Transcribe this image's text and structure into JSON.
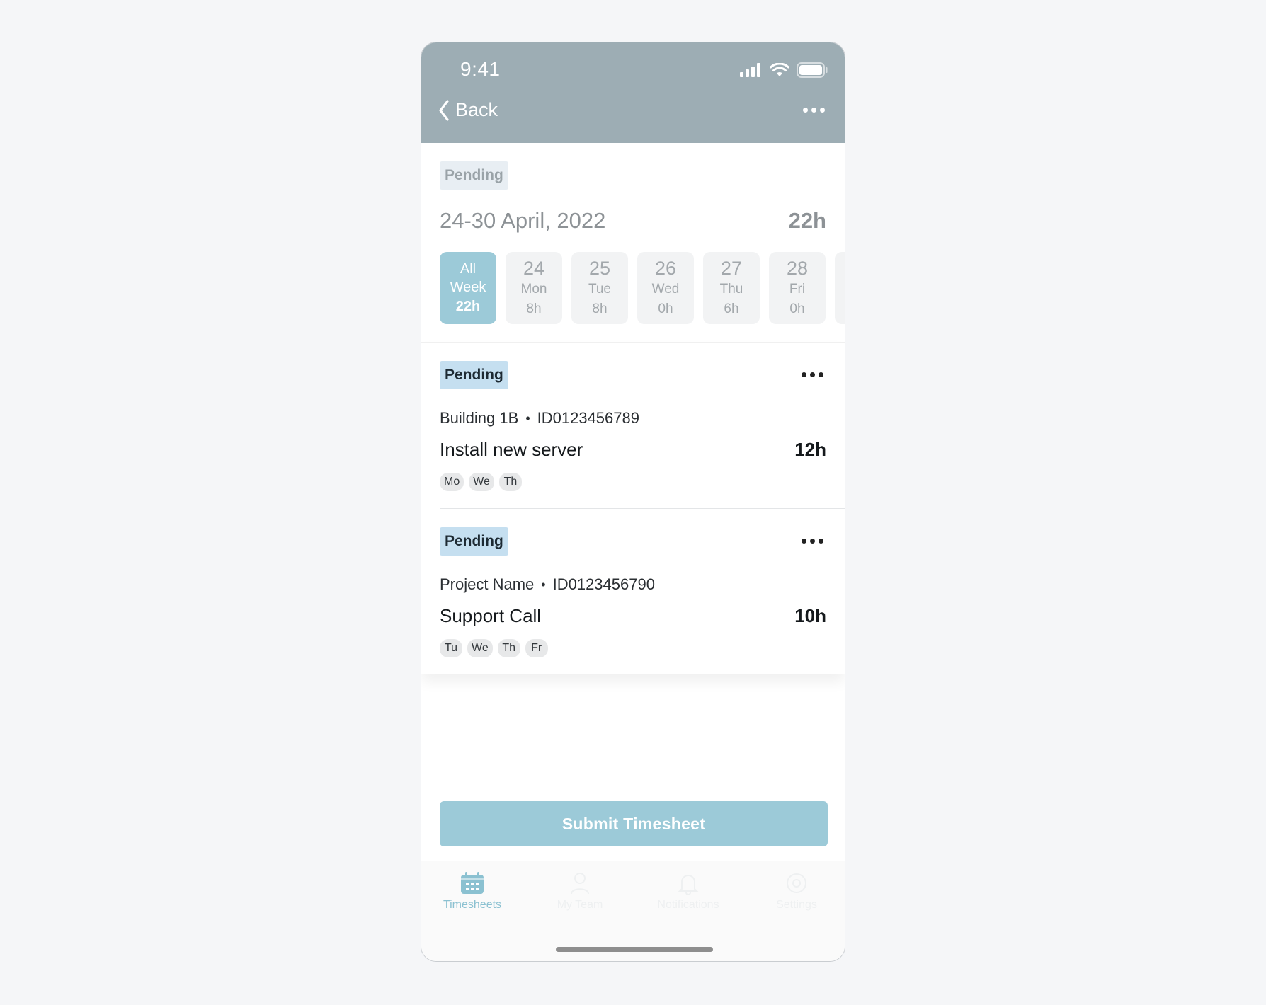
{
  "status_bar": {
    "time": "9:41"
  },
  "nav": {
    "back_label": "Back"
  },
  "summary": {
    "status": "Pending",
    "date_range": "24-30 April, 2022",
    "total_hours": "22h",
    "days": [
      {
        "line1": "All",
        "line2": "Week",
        "hours": "22h",
        "active": true
      },
      {
        "line1": "24",
        "line2": "Mon",
        "hours": "8h"
      },
      {
        "line1": "25",
        "line2": "Tue",
        "hours": "8h"
      },
      {
        "line1": "26",
        "line2": "Wed",
        "hours": "0h"
      },
      {
        "line1": "27",
        "line2": "Thu",
        "hours": "6h"
      },
      {
        "line1": "28",
        "line2": "Fri",
        "hours": "0h"
      }
    ]
  },
  "entries": [
    {
      "status": "Pending",
      "location": "Building 1B",
      "separator": "•",
      "id": "ID0123456789",
      "task": "Install new server",
      "hours": "12h",
      "days": [
        "Mo",
        "We",
        "Th"
      ]
    },
    {
      "status": "Pending",
      "location": "Project Name",
      "separator": "•",
      "id": "ID0123456790",
      "task": "Support Call",
      "hours": "10h",
      "days": [
        "Tu",
        "We",
        "Th",
        "Fr"
      ]
    }
  ],
  "actions": {
    "submit_label": "Submit Timesheet"
  },
  "tabs": [
    {
      "label": "Timesheets",
      "icon": "calendar-icon",
      "active": true
    },
    {
      "label": "My Team",
      "icon": "person-icon"
    },
    {
      "label": "Notifications",
      "icon": "bell-icon"
    },
    {
      "label": "Settings",
      "icon": "gear-icon"
    }
  ],
  "colors": {
    "header": "#9dadb4",
    "accent": "#9ccad8",
    "badge": "#c5dff0"
  }
}
